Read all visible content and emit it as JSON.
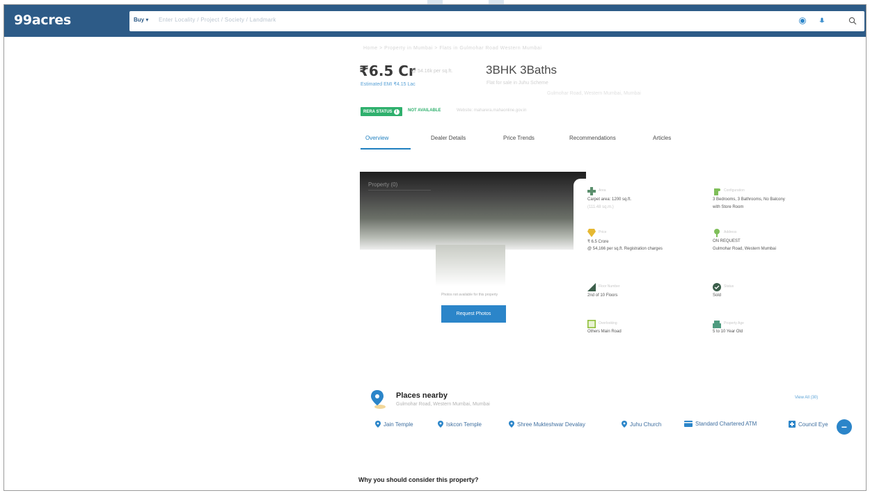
{
  "header": {
    "logo": "99acres",
    "buy_label": "Buy",
    "search_placeholder": "Enter Locality / Project / Society / Landmark",
    "colors": {
      "bar": "#2d5b87",
      "accent": "#2b85c9",
      "green": "#2fb06d"
    }
  },
  "listing": {
    "breadcrumb": "Home  >  Property in Mumbai  >  Flats in Gulmohar Road Western Mumbai",
    "price": "₹6.5 Cr",
    "price_note": "@ 54.16k per sq.ft.",
    "emi": "Estimated EMI ₹4.15 Lac",
    "config": "3BHK 3Baths",
    "config_sub1": "Flat for sale in Juhu Scheme",
    "config_sub2": "Gulmohar Road, Western Mumbai, Mumbai",
    "rera_badge": "RERA STATUS",
    "not_available": "NOT AVAILABLE",
    "rera_note": "Website: maharera.mahaonline.gov.in"
  },
  "tabs": [
    {
      "label": "Overview"
    },
    {
      "label": "Dealer Details"
    },
    {
      "label": "Price Trends"
    },
    {
      "label": "Recommendations"
    },
    {
      "label": "Articles"
    }
  ],
  "photo": {
    "label": "Property (0)",
    "note": "Photos not available for this property",
    "button": "Request Photos"
  },
  "details": [
    {
      "icon": "area-icon",
      "label": "Area",
      "value": "Carpet area: 1200 sq.ft.",
      "value2": "(111.48 sq.m.)",
      "color": "#5b8f6d"
    },
    {
      "icon": "config-icon",
      "label": "Configuration",
      "value": "3 Bedrooms, 3 Bathrooms, No Balcony",
      "value2": "with Store Room",
      "color": "#7fbf5a"
    },
    {
      "icon": "price-icon",
      "label": "Price",
      "value": "₹ 6.5 Crore",
      "value2": "@ 54,166 per sq.ft. Registration charges",
      "color": "#e6b832"
    },
    {
      "icon": "address-icon",
      "label": "Address",
      "value": "ON REQUEST",
      "value2": "Gulmohar Road, Western Mumbai",
      "color": "#7fbf5a"
    },
    {
      "icon": "floor-icon",
      "label": "Floor Number",
      "value": "2nd of 10 Floors",
      "value2": "",
      "color": "#3b5e4a"
    },
    {
      "icon": "status-icon",
      "label": "Status",
      "value": "Sold",
      "value2": "",
      "color": "#3b5e4a"
    },
    {
      "icon": "facing-icon",
      "label": "Overlooking",
      "value": "Others Main Road",
      "value2": "",
      "color": "#8fbf3a"
    },
    {
      "icon": "age-icon",
      "label": "Property Age",
      "value": "5 to 10 Year Old",
      "value2": "",
      "color": "#4e9b7f"
    }
  ],
  "places": {
    "title": "Places nearby",
    "subtitle": "Gulmohar Road, Western Mumbai, Mumbai",
    "view_all": "View All (30)",
    "chips": [
      {
        "icon": "pin-icon",
        "label": "Jain Temple"
      },
      {
        "icon": "pin-icon",
        "label": "Iskcon Temple"
      },
      {
        "icon": "pin-icon",
        "label": "Shree Mukteshwar Devalay"
      },
      {
        "icon": "pin-icon",
        "label": "Juhu Church"
      },
      {
        "icon": "atm-icon",
        "label": "Standard Chartered ATM"
      },
      {
        "icon": "hospital-icon",
        "label": "Council Eye"
      }
    ]
  },
  "why_title": "Why you should consider this property?"
}
